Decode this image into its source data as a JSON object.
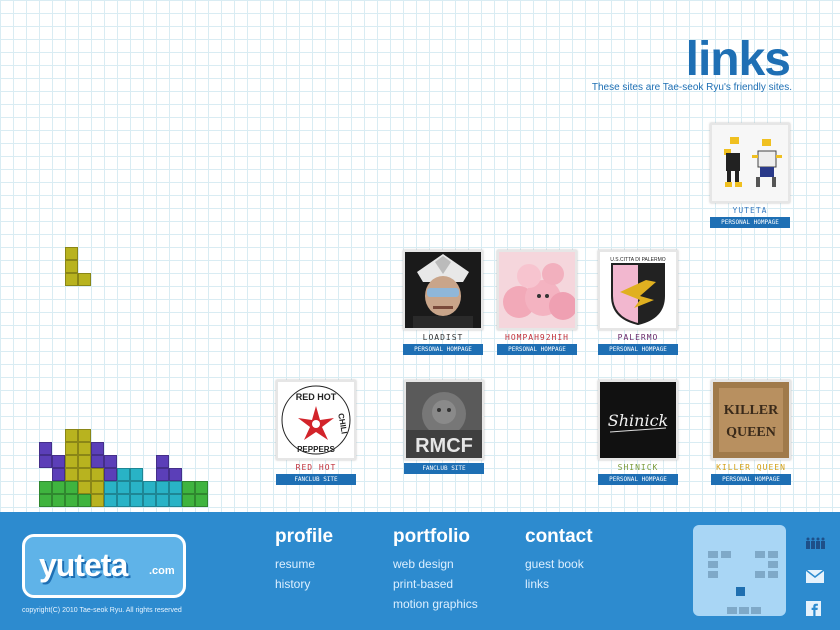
{
  "header": {
    "title": "links",
    "subtitle": "These sites are Tae-seok Ryu's friendly sites."
  },
  "links": [
    {
      "id": "yuteta",
      "name": "yuteta",
      "type": "personal hompage",
      "name_color": "#3a7bc0"
    },
    {
      "id": "loadist",
      "name": "loadist",
      "type": "personal hompage",
      "name_color": "#333333"
    },
    {
      "id": "hompah92hih",
      "name": "hompah92hih",
      "type": "personal hompage",
      "name_color": "#c0303a"
    },
    {
      "id": "palermo",
      "name": "palermo",
      "type": "personal hompage",
      "name_color": "#6a2a6a"
    },
    {
      "id": "redhot",
      "name": "red hot",
      "type": "fanclub site",
      "name_color": "#c0303a"
    },
    {
      "id": "rmcf",
      "name": "",
      "type": "fanclub site",
      "name_color": "#333333"
    },
    {
      "id": "shinick",
      "name": "shinick",
      "type": "personal hompage",
      "name_color": "#7a9a3a"
    },
    {
      "id": "killerqueen",
      "name": "killer queen",
      "type": "personal hompage",
      "name_color": "#d4a017"
    }
  ],
  "thumb_text": {
    "redhot_lines": [
      "RED HOT",
      "CHILI",
      "PEPPERS"
    ],
    "rmcf": "RMCF",
    "palermo_top": "U.S.CITTA DI PALERMO",
    "shinick": "Shinick",
    "killer": "KILLER",
    "queen": "QUEEN"
  },
  "footer": {
    "logo_text": "yuteta",
    "logo_suffix": ".com",
    "copyright": "copyright(C) 2010 Tae-seok Ryu. All rights reserved",
    "nav": [
      {
        "heading": "profile",
        "links": [
          "resume",
          "history"
        ]
      },
      {
        "heading": "portfolio",
        "links": [
          "web design",
          "print-based",
          "motion graphics"
        ]
      },
      {
        "heading": "contact",
        "links": [
          "guest book",
          "links"
        ]
      }
    ],
    "side_icons": [
      "myspace-icon",
      "mail-icon",
      "facebook-icon"
    ]
  },
  "colors": {
    "accent": "#1e6fb4",
    "footer_bg": "#2d8bcf",
    "tetris_yellow": "#b8b31f",
    "tetris_purple": "#5b3fb8",
    "tetris_cyan": "#29b3c6",
    "tetris_green": "#3fb43f"
  }
}
